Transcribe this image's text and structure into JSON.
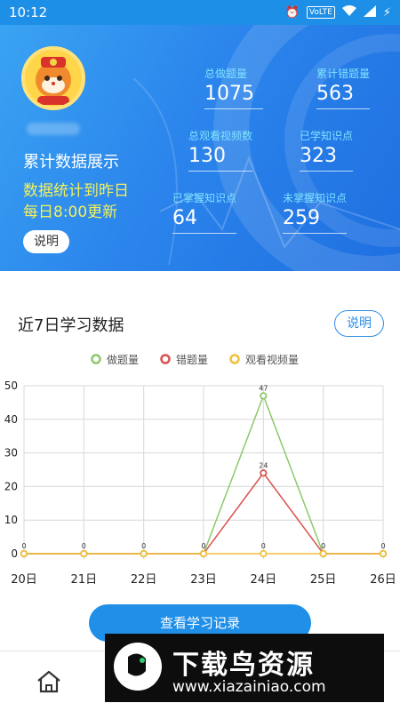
{
  "status_bar": {
    "time": "10:12",
    "volte": "VoLTE"
  },
  "hero": {
    "title": "累计数据展示",
    "note_line1": "数据统计到昨日",
    "note_line2": "每日8:00更新",
    "explain_button": "说明",
    "stats": [
      {
        "label": "总做题量",
        "value": "1075"
      },
      {
        "label": "累计错题量",
        "value": "563"
      },
      {
        "label": "总观看视频数",
        "value": "130"
      },
      {
        "label": "已学知识点",
        "value": "323"
      },
      {
        "label": "已掌握知识点",
        "value": "64"
      },
      {
        "label": "未掌握知识点",
        "value": "259"
      }
    ]
  },
  "section": {
    "title": "近7日学习数据",
    "explain_button": "说明"
  },
  "chart_data": {
    "type": "line",
    "categories": [
      "20日",
      "21日",
      "22日",
      "23日",
      "24日",
      "25日",
      "26日"
    ],
    "series": [
      {
        "name": "做题量",
        "values": [
          0,
          0,
          0,
          0,
          47,
          0,
          0
        ],
        "color": "#8dc86b"
      },
      {
        "name": "错题量",
        "values": [
          0,
          0,
          0,
          0,
          24,
          0,
          0
        ],
        "color": "#d9534f"
      },
      {
        "name": "观看视频量",
        "values": [
          0,
          0,
          0,
          0,
          0,
          0,
          0
        ],
        "color": "#f0c13c"
      }
    ],
    "y_ticks": [
      "0",
      "10",
      "20",
      "30",
      "40",
      "50"
    ],
    "ylim": [
      0,
      50
    ],
    "data_labels": [
      "0",
      "0",
      "0",
      "0",
      "47",
      "24",
      "0",
      "0",
      "0"
    ],
    "legend_position": "top-center",
    "grid": true
  },
  "history_button": "查看学习记录",
  "nav": {
    "home_icon": "home-icon"
  },
  "watermark": {
    "brand": "下载鸟资源",
    "url": "www.xiazainiao.com"
  }
}
